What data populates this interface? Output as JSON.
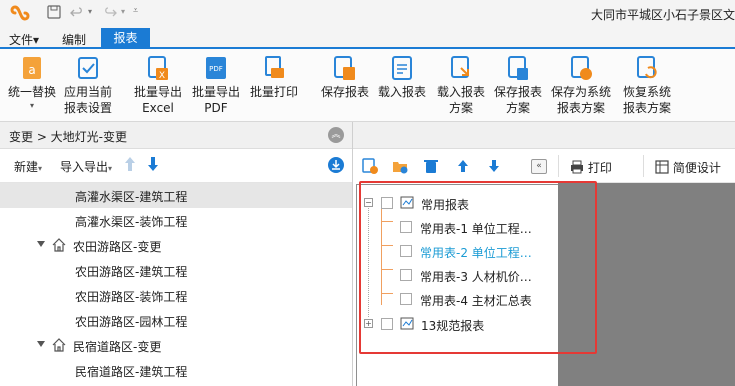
{
  "window": {
    "title": "大同市平城区小石子景区文"
  },
  "menu": {
    "file": "文件▾",
    "edit": "编制",
    "report_tab": "报表"
  },
  "ribbon": {
    "replace": "统一替换",
    "apply_settings_1": "应用当前",
    "apply_settings_2": "报表设置",
    "export_excel_1": "批量导出",
    "export_excel_2": "Excel",
    "export_pdf_1": "批量导出",
    "export_pdf_2": "PDF",
    "batch_print": "批量打印",
    "save_report": "保存报表",
    "load_report": "载入报表",
    "load_scheme_1": "载入报表",
    "load_scheme_2": "方案",
    "save_scheme_1": "保存报表",
    "save_scheme_2": "方案",
    "save_as_system_1": "保存为系统",
    "save_as_system_2": "报表方案",
    "restore_system_1": "恢复系统",
    "restore_system_2": "报表方案"
  },
  "left_panel": {
    "breadcrumb": "变更 > 大地灯光-变更",
    "new_label": "新建",
    "import_export_label": "导入导出",
    "tree": [
      {
        "label": "高灌水渠区-建筑工程",
        "level": 2,
        "selected": true
      },
      {
        "label": "高灌水渠区-装饰工程",
        "level": 2
      },
      {
        "label": "农田游路区-变更",
        "level": 1
      },
      {
        "label": "农田游路区-建筑工程",
        "level": 2
      },
      {
        "label": "农田游路区-装饰工程",
        "level": 2
      },
      {
        "label": "农田游路区-园林工程",
        "level": 2
      },
      {
        "label": "民宿道路区-变更",
        "level": 1
      },
      {
        "label": "民宿道路区-建筑工程",
        "level": 2
      }
    ]
  },
  "right_toolbar": {
    "print_label": "打印",
    "simple_design_label": "简便设计"
  },
  "reports": {
    "groups": [
      {
        "label": "常用报表",
        "expander": "−"
      },
      {
        "label": "13规范报表",
        "expander": "+"
      }
    ],
    "items": [
      {
        "label": "常用表-1 单位工程…",
        "active": false
      },
      {
        "label": "常用表-2 单位工程…",
        "active": true
      },
      {
        "label": "常用表-3 人材机价…",
        "active": false
      },
      {
        "label": "常用表-4 主材汇总表",
        "active": false
      }
    ]
  },
  "colors": {
    "accent": "#1b7bd4",
    "highlight_border": "#e53935",
    "active_item": "#1b9bd4"
  }
}
